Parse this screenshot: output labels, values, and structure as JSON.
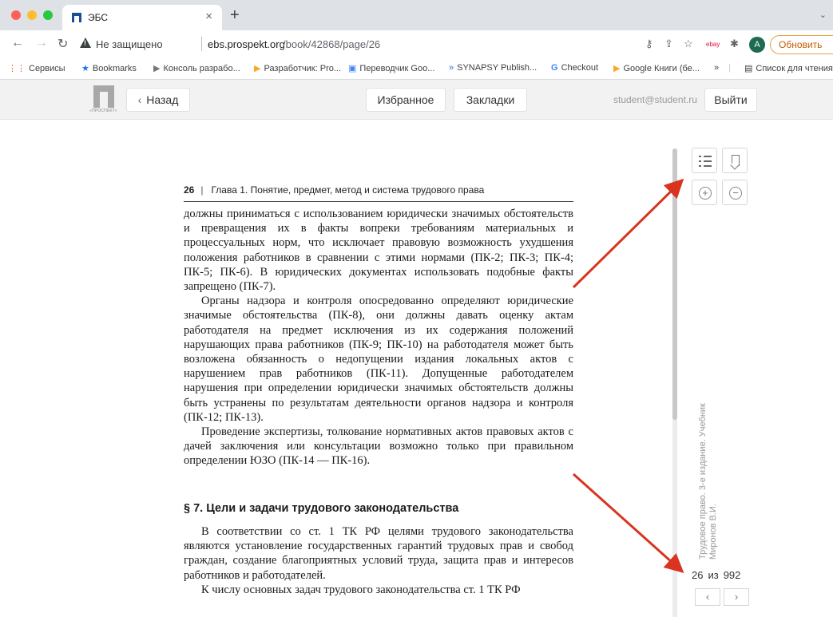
{
  "browser": {
    "tab_title": "ЭБС",
    "tab_close": "×",
    "new_tab": "+",
    "tabbar_chevron": "⌄",
    "insecure_label": "Не защищено",
    "url_host": "ebs.prospekt.org",
    "url_path": "/book/42868/page/26",
    "avatar_letter": "A",
    "update_label": "Обновить"
  },
  "bookmarks_bar": {
    "items": [
      {
        "icon": "apps-grid-icon",
        "label": "Сервисы"
      },
      {
        "icon": "star-icon",
        "label": "Bookmarks"
      },
      {
        "icon": "folder-icon",
        "label": "Консоль разрабо..."
      },
      {
        "icon": "play-icon",
        "label": "Разработчик: Pro..."
      },
      {
        "icon": "translate-icon",
        "label": "Переводчик Goo..."
      },
      {
        "icon": "synapsy-icon",
        "label": "SYNAPSY Publish..."
      },
      {
        "icon": "google-icon",
        "label": "Checkout"
      },
      {
        "icon": "play-icon",
        "label": "Google Книги (бе..."
      }
    ],
    "overflow": "»",
    "reading_list": "Список для чтения"
  },
  "site_header": {
    "logo_text": "«ПРОСПЕКТ»",
    "back_label": "Назад",
    "favorites_label": "Избранное",
    "bookmarks_label": "Закладки",
    "user_email": "student@student.ru",
    "logout_label": "Выйти"
  },
  "reader": {
    "page_number": "26",
    "chapter_title": "Глава 1. Понятие, предмет, метод и система трудового права",
    "paragraph_1": "должны приниматься с использованием юридически значимых обстоятельств и превращения их в факты вопреки требованиям материальных и процессуальных норм, что исключает правовую возможность ухудшения положения работников в сравнении с этими нормами (ПК-2; ПК-3; ПК-4; ПК-5; ПК-6). В юридических документах использовать подобные факты запрещено (ПК-7).",
    "paragraph_2": "Органы надзора и контроля опосредованно определяют юридические значимые обстоятельства (ПК-8), они должны давать оценку актам работодателя на предмет исключения из их содержания положений нарушающих права работников (ПК-9; ПК-10) на работодателя может быть возложена обязанность о недопущении издания локальных актов с нарушением прав работников (ПК-11). Допущенные работодателем нарушения при определении юридически значимых обстоятельств должны быть устранены по результатам деятельности органов надзора и контроля (ПК-12; ПК-13).",
    "paragraph_3": "Проведение экспертизы, толкование нормативных актов правовых актов с дачей заключения или консультации возможно только при правильном определении ЮЗО (ПК-14 — ПК-16).",
    "section_title": "§ 7. Цели и задачи трудового законодательства",
    "paragraph_4": "В соответствии со ст. 1 ТК РФ целями трудового законодательства являются установление государственных гарантий трудовых прав и свобод граждан, создание благоприятных условий труда, защита прав и интересов работников и работодателей.",
    "paragraph_5": "К числу основных задач трудового законодательства ст. 1 ТК РФ",
    "book_title_vertical": "Трудовое право. 3-е издание. Учебник",
    "book_author_vertical": "Миронов В.И.",
    "current_page": "26",
    "of_label": "из",
    "total_pages": "992",
    "prev_glyph": "‹",
    "next_glyph": "›",
    "zoom_in_glyph": "+",
    "zoom_out_glyph": "−"
  },
  "colors": {
    "annotation_arrow": "#d8341f",
    "update_accent": "#c45e00"
  }
}
